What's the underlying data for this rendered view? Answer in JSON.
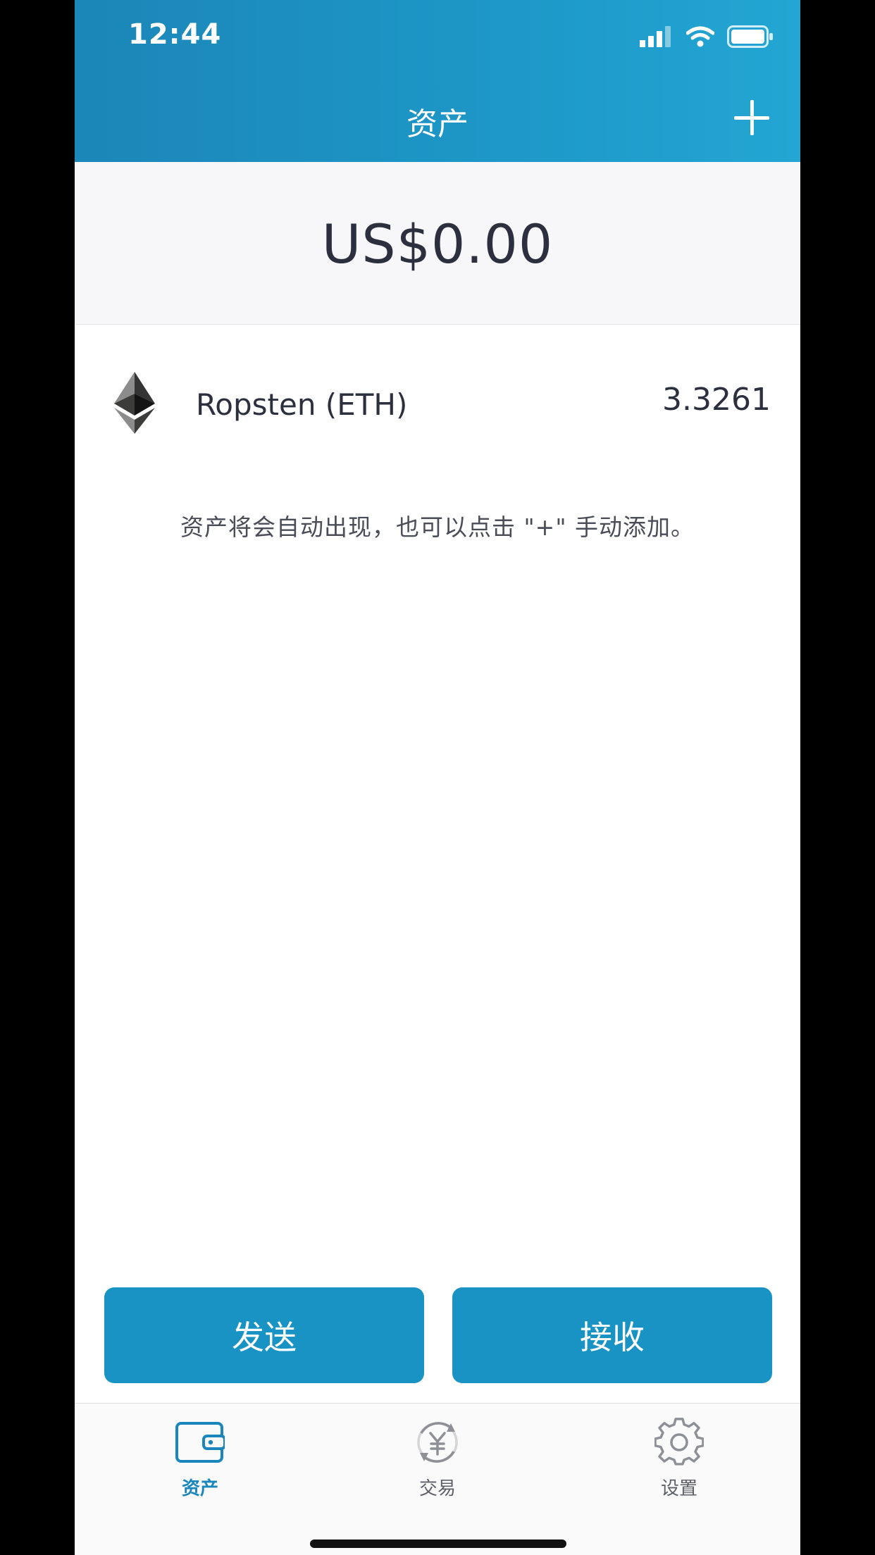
{
  "status_bar": {
    "time": "12:44"
  },
  "nav": {
    "title": "资产",
    "add_icon": "plus-icon"
  },
  "portfolio": {
    "total_balance": "US$0.00"
  },
  "assets": [
    {
      "name": "Ropsten (ETH)",
      "amount": "3.3261",
      "icon": "ethereum-icon"
    }
  ],
  "hint": "资产将会自动出现，也可以点击 \"+\" 手动添加。",
  "actions": {
    "send_label": "发送",
    "receive_label": "接收"
  },
  "tabbar": {
    "tabs": [
      {
        "label": "资产",
        "icon": "wallet-icon",
        "active": true
      },
      {
        "label": "交易",
        "icon": "exchange-yuan-icon",
        "active": false
      },
      {
        "label": "设置",
        "icon": "gear-icon",
        "active": false
      }
    ]
  },
  "colors": {
    "header_start": "#1b86b8",
    "header_end": "#23a6d3",
    "button": "#1893c4",
    "active_tab": "#1a86bb",
    "inactive_tab": "#8e9097",
    "text_primary": "#2b2f3e"
  }
}
